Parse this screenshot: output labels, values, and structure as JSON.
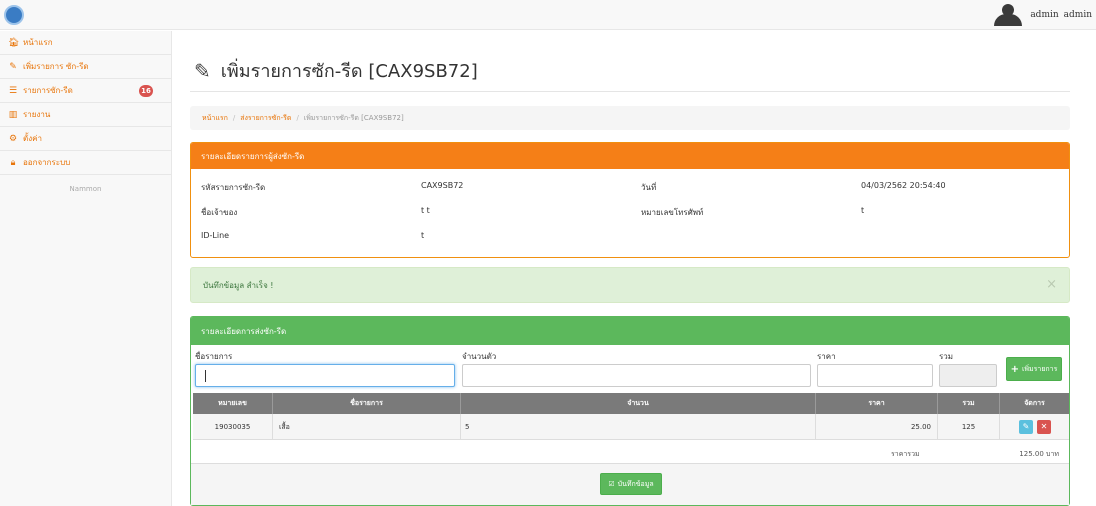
{
  "header": {
    "user_name": "admin",
    "user_role": "admin"
  },
  "sidebar": {
    "items": [
      {
        "label": "หน้าแรก",
        "icon": "home-icon"
      },
      {
        "label": "เพิ่มรายการ ซัก-รีด",
        "icon": "edit-icon"
      },
      {
        "label": "รายการซัก-รีด",
        "icon": "list-icon",
        "badge": "16"
      },
      {
        "label": "รายงาน",
        "icon": "bar-chart-icon"
      },
      {
        "label": "ตั้งค่า",
        "icon": "gear-icon"
      },
      {
        "label": "ออกจากระบบ",
        "icon": "lock-icon"
      }
    ],
    "footer": "Nammon"
  },
  "page": {
    "title": "เพิ่มรายการซัก-รีด [CAX9SB72]"
  },
  "breadcrumb": {
    "home": "หน้าแรก",
    "list": "ส่งรายการซัก-รีด",
    "current": "เพิ่มรายการซัก-รีด [CAX9SB72]"
  },
  "info_panel": {
    "heading": "รายละเอียดรายการผู้ส่งซัก-รีด",
    "order_code_label": "รหัสรายการซัก-รีด",
    "order_code_value": "CAX9SB72",
    "date_label": "วันที่",
    "date_value": "04/03/2562 20:54:40",
    "owner_label": "ชื่อเจ้าของ",
    "owner_value": "t  t",
    "phone_label": "หมายเลขโทรศัพท์",
    "phone_value": "t",
    "line_label": "ID-Line",
    "line_value": "t"
  },
  "alert": {
    "message": "บันทึกข้อมูล สำเร็จ !",
    "close": "×"
  },
  "detail_panel": {
    "heading": "รายละเอียดการส่งซัก-รีด",
    "form": {
      "item_label": "ชื่อรายการ",
      "qty_label": "จำนวนตัว",
      "price_label": "ราคา",
      "total_label": "รวม",
      "add_button": "เพิ่มรายการ"
    },
    "table": {
      "headers": [
        "หมายเลข",
        "ชื่อรายการ",
        "จำนวน",
        "ราคา",
        "รวม",
        "จัดการ"
      ],
      "rows": [
        {
          "number": "19030035",
          "name": "เสื้อ",
          "qty": "5",
          "price": "25.00",
          "total": "125"
        }
      ]
    },
    "sum_label": "ราคารวม",
    "sum_value": "125.00 บาท",
    "save_button": "บันทึกข้อมูล"
  },
  "colors": {
    "accent_orange": "#f57f17",
    "success_green": "#5cb85c",
    "danger_red": "#d9534f",
    "info_blue": "#5bc0de"
  }
}
